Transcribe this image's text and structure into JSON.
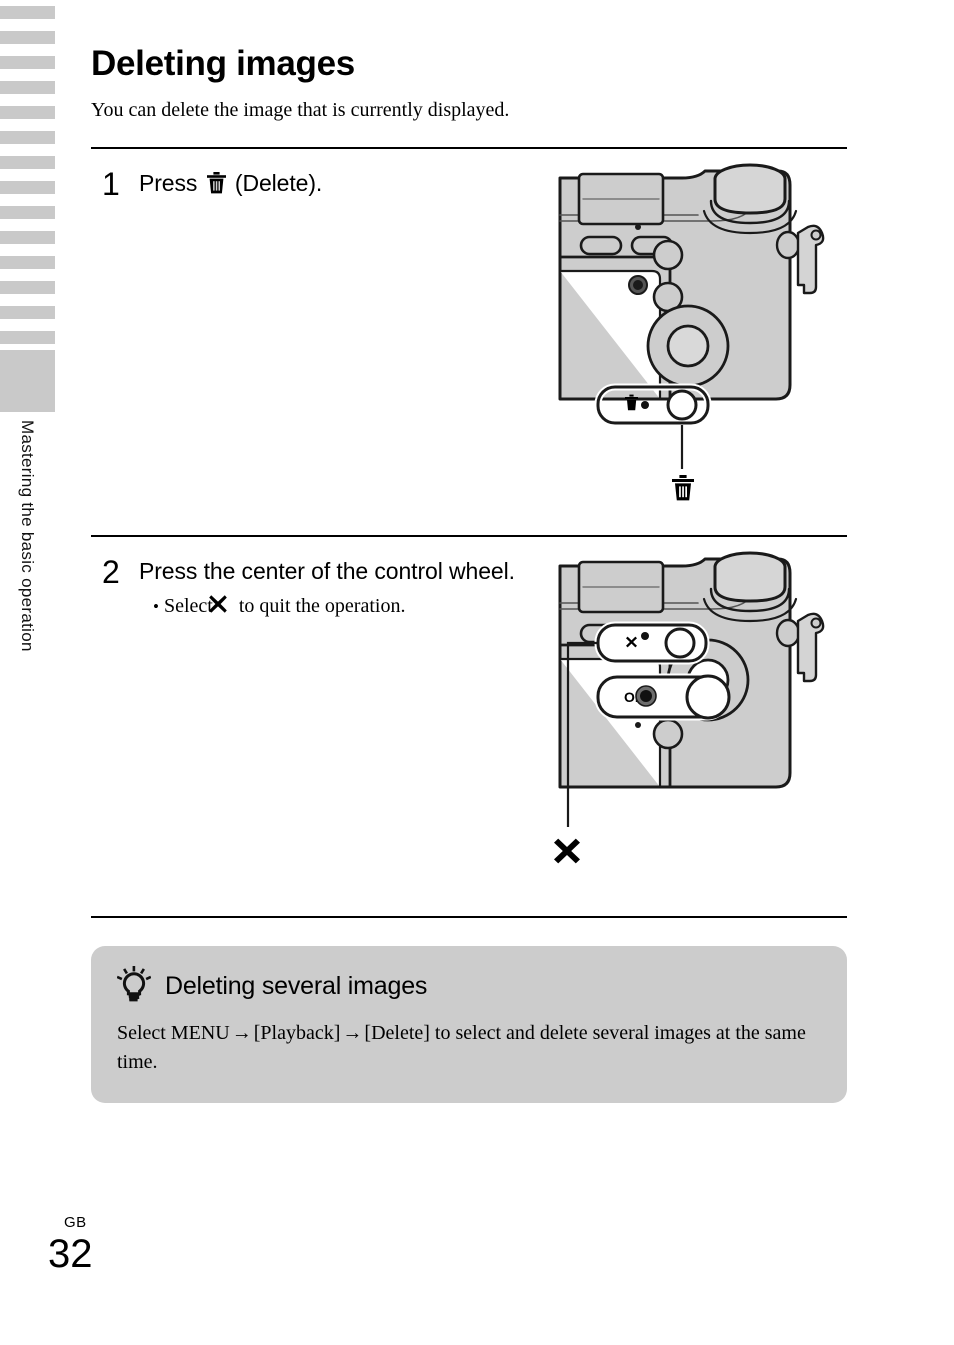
{
  "page": {
    "title": "Deleting images",
    "intro": "You can delete the image that is currently displayed.",
    "side_chapter": "Mastering the basic operation",
    "folio_region": "GB",
    "folio_number": "32"
  },
  "steps": [
    {
      "number": "1",
      "heading_before_icon": "Press",
      "icon": "trash-icon",
      "heading_after_icon": "(Delete).",
      "bullets": [],
      "figure": {
        "name": "camera-rear-delete-button",
        "callouts": [
          {
            "glyph": "trash-icon",
            "dot": true
          }
        ],
        "leader_label": "trash-icon"
      }
    },
    {
      "number": "2",
      "heading": "Press the center of the control wheel.",
      "bullets": [
        {
          "text_before_icon": "Select",
          "icon": "x-mark-icon",
          "text_after_icon": "to quit the operation."
        }
      ],
      "figure": {
        "name": "camera-rear-control-wheel",
        "callouts": [
          {
            "glyph": "x-mark-icon",
            "dot": true
          },
          {
            "glyph": "OK",
            "dot": true
          }
        ],
        "leader_label": "x-mark-icon"
      }
    }
  ],
  "tip": {
    "icon": "lightbulb-icon",
    "title": "Deleting several images",
    "body_parts": [
      "Select MENU",
      "[Playback]",
      "[Delete] to select and delete several images at the same time."
    ],
    "arrow": "→",
    "body_full": "Select MENU → [Playback] → [Delete] to select and delete several images at the same time."
  },
  "colors": {
    "tab_gray": "#c9c9c9",
    "tip_background": "#cccccc",
    "camera_body": "#cdcdcd",
    "camera_outline": "#1a1a1a",
    "page_background": "#ffffff"
  }
}
